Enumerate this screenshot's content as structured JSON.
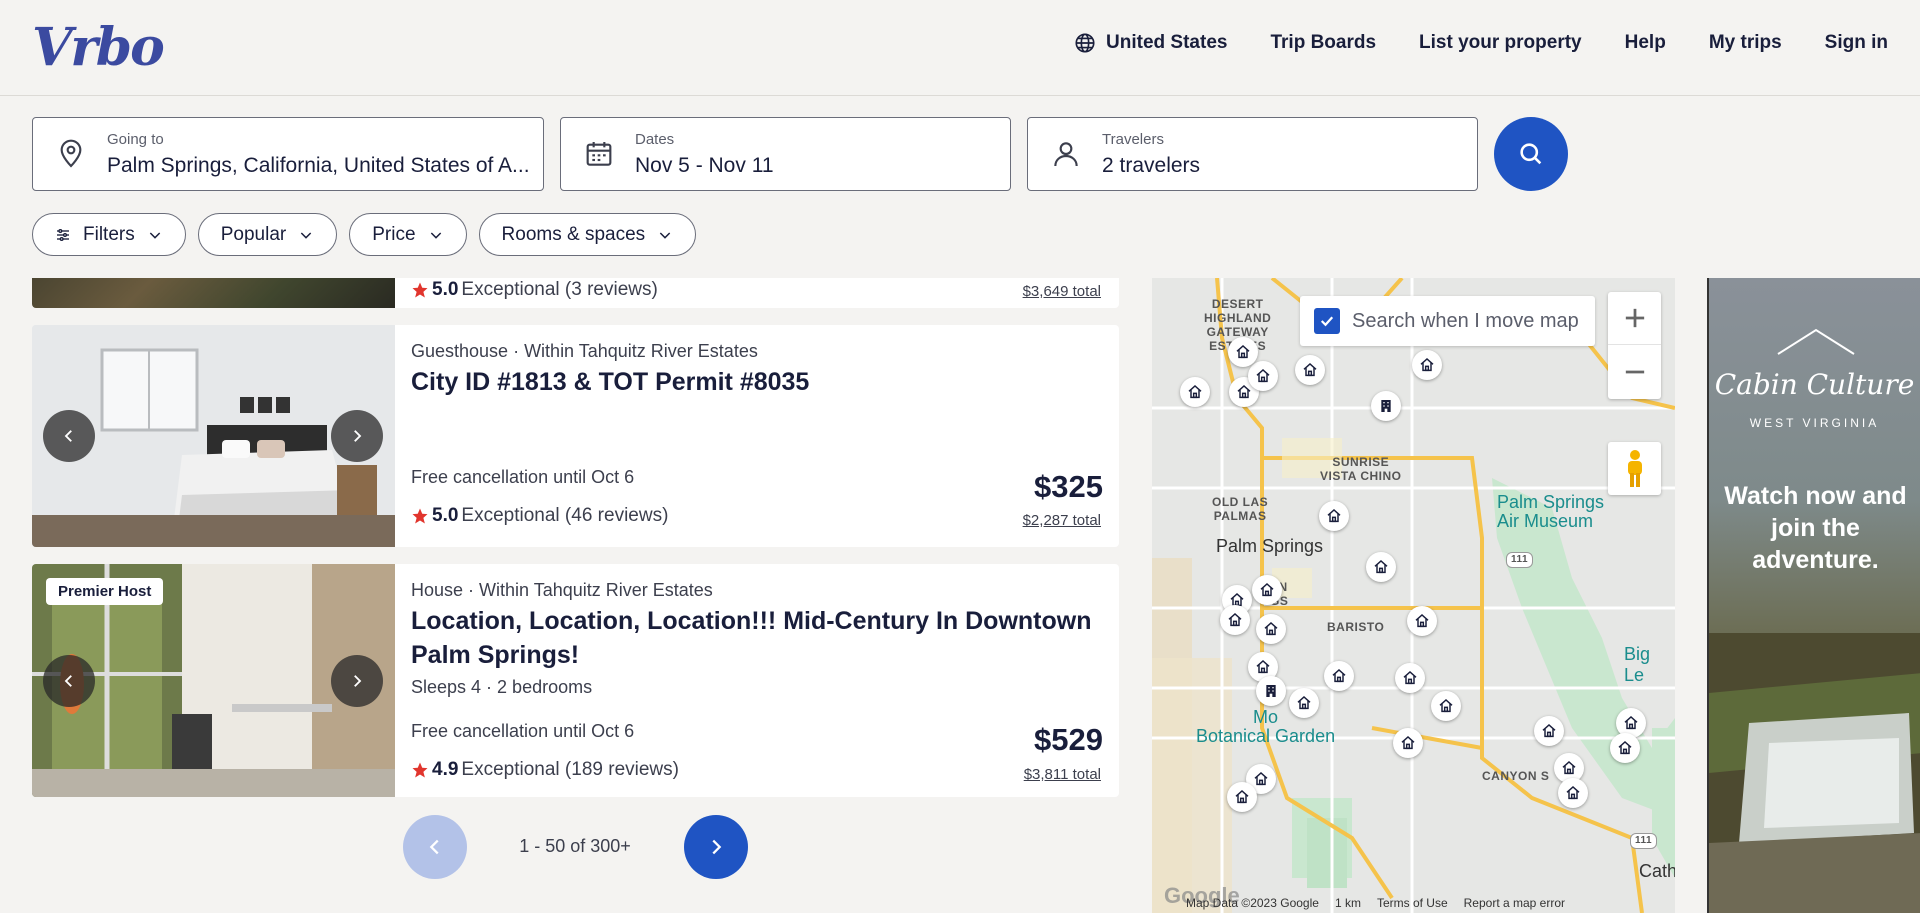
{
  "header": {
    "logo": "Vrbo",
    "nav": [
      {
        "label": "United States",
        "icon": "globe-icon"
      },
      {
        "label": "Trip Boards"
      },
      {
        "label": "List your property"
      },
      {
        "label": "Help"
      },
      {
        "label": "My trips"
      },
      {
        "label": "Sign in"
      }
    ]
  },
  "search": {
    "going_to": {
      "label": "Going to",
      "value": "Palm Springs, California, United States of A..."
    },
    "dates": {
      "label": "Dates",
      "value": "Nov 5 - Nov 11"
    },
    "travelers": {
      "label": "Travelers",
      "value": "2 travelers"
    }
  },
  "filters": [
    "Filters",
    "Popular",
    "Price",
    "Rooms & spaces"
  ],
  "listings": [
    {
      "rating": "5.0",
      "rating_text": "Exceptional (3 reviews)",
      "total": "$3,649 total"
    },
    {
      "type": "Guesthouse · Within Tahquitz River Estates",
      "title": "City ID #1813 & TOT Permit #8035",
      "cancellation": "Free cancellation until Oct 6",
      "rating": "5.0",
      "rating_text": "Exceptional (46 reviews)",
      "price": "$325",
      "total": "$2,287 total"
    },
    {
      "badge": "Premier Host",
      "type": "House · Within Tahquitz River Estates",
      "title": "Location, Location, Location!!! Mid-Century In Downtown Palm Springs!",
      "sleeps": "Sleeps 4 · 2 bedrooms",
      "cancellation": "Free cancellation until Oct 6",
      "rating": "4.9",
      "rating_text": "Exceptional (189 reviews)",
      "price": "$529",
      "total": "$3,811 total"
    }
  ],
  "pagination": {
    "text": "1 - 50 of 300+"
  },
  "map": {
    "search_move": "Search when I move map",
    "labels": {
      "desert_highland": "DESERT\nHIGHLAND\nGATEWAY\nESTATES",
      "sunrise": "SUNRISE\nVISTA CHINO",
      "old_las_palmas": "OLD LAS\nPALMAS",
      "palm_springs": "Palm Springs",
      "museum": "Palm Springs\nAir Museum",
      "baristo": "BARISTO",
      "big_l": "Big Le",
      "botanical": "Mo\nBotanical Garden",
      "canyon": "CANYON S",
      "cath": "Cath",
      "road_111a": "111",
      "road_111b": "111",
      "vn": "VN",
      "gs": "GS"
    },
    "footer": [
      "Map Data ©2023 Google",
      "1 km",
      "Terms of Use",
      "Report a map error"
    ],
    "google": "Google"
  },
  "ad": {
    "brand": "Cabin Culture",
    "sub": "WEST VIRGINIA",
    "cta": "Watch now and join the adventure."
  },
  "colors": {
    "accent": "#1f54c3",
    "star": "#e1352d",
    "brand": "#3b4aa0"
  }
}
